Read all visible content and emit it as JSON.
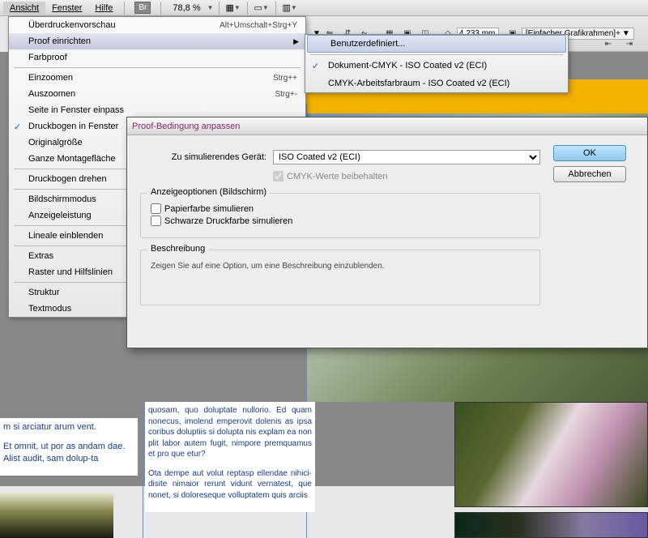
{
  "menubar": {
    "ansicht": "Ansicht",
    "fenster": "Fenster",
    "hilfe": "Hilfe",
    "br": "Br",
    "zoom": "78,8 %"
  },
  "toolbar2": {
    "mm_value": "4,233 mm",
    "frame_label": "[Einfacher Grafikrahmen]+"
  },
  "menu": {
    "ueberdrucken": "Überdruckenvorschau",
    "ueberdrucken_sc": "Alt+Umschalt+Strg+Y",
    "proof_einrichten": "Proof einrichten",
    "farbproof": "Farbproof",
    "einzoomen": "Einzoomen",
    "einzoomen_sc": "Strg++",
    "auszoomen": "Auszoomen",
    "auszoomen_sc": "Strg+-",
    "seite_fenster": "Seite in Fenster einpass",
    "druckbogen_fenster": "Druckbogen in Fenster",
    "originalgroesse": "Originalgröße",
    "ganze_montage": "Ganze Montagefläche",
    "druckbogen_drehen": "Druckbogen drehen",
    "bildschirmmodus": "Bildschirmmodus",
    "anzeigeleistung": "Anzeigeleistung",
    "lineale": "Lineale einblenden",
    "extras": "Extras",
    "raster": "Raster und Hilfslinien",
    "struktur": "Struktur",
    "textmodus": "Textmodus"
  },
  "submenu": {
    "benutzerdefiniert": "Benutzerdefiniert...",
    "dokument_cmyk": "Dokument-CMYK - ISO Coated v2 (ECI)",
    "arbeitsfarbraum": "CMYK-Arbeitsfarbraum - ISO Coated v2 (ECI)"
  },
  "dialog": {
    "title": "Proof-Bedingung anpassen",
    "device_label": "Zu simulierendes Gerät:",
    "device_value": "ISO Coated v2 (ECI)",
    "cmyk_preserve": "CMYK-Werte beibehalten",
    "group_display": "Anzeigeoptionen (Bildschirm)",
    "paper_sim": "Papierfarbe simulieren",
    "black_sim": "Schwarze Druckfarbe simulieren",
    "group_desc": "Beschreibung",
    "desc_text": "Zeigen Sie auf eine Option, um eine Beschreibung einzublenden.",
    "ok": "OK",
    "cancel": "Abbrechen"
  },
  "bodytext": {
    "col1a": "m si arciatur arum vent.",
    "col1b": "Et omnit, ut por as andam dae. Alist audit, sam dolup-ta",
    "col2a": "quosam, quo doluptate nullorio. Ed quam nonecus, imolend emperovit dolenis as ipsa coribus doluptiis si dolupta nis explam ea non plit labor autem fugit, nimpore premquamus et pro que etur?",
    "col2b": "Ota dempe aut volut reptasp ellendae nihici-disite nimaior rerunt vidunt vernatest, que nonet, si doloreseque volluptatem quis arciis"
  }
}
